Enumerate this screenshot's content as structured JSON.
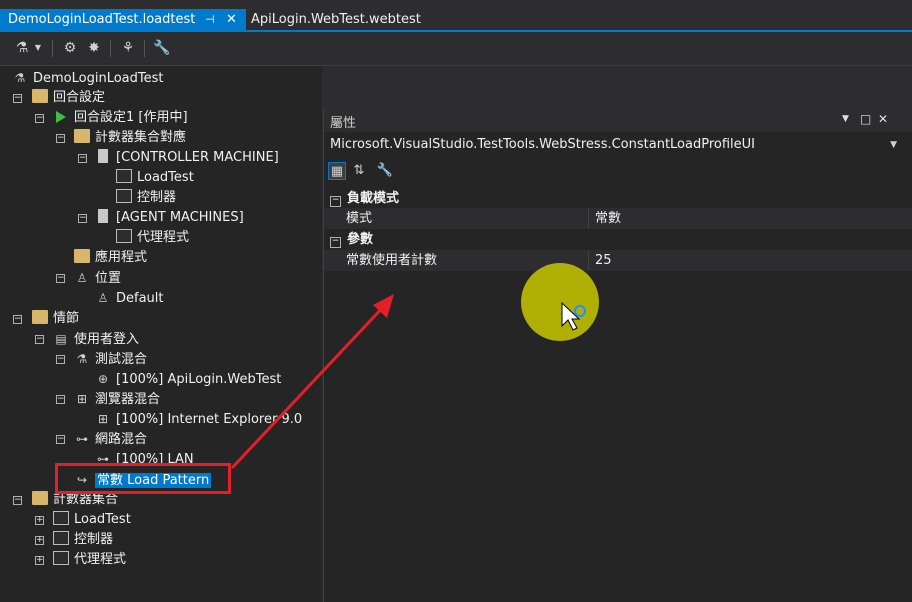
{
  "tabs": [
    {
      "label": "DemoLoginLoadTest.loadtest",
      "pin": "⊣",
      "close": "✕"
    },
    {
      "label": "ApiLogin.WebTest.webtest"
    }
  ],
  "tree": {
    "nodes": [
      {
        "label": "DemoLoginLoadTest"
      },
      {
        "label": "回合設定"
      },
      {
        "label": "回合設定1 [作用中]"
      },
      {
        "label": "計數器集合對應"
      },
      {
        "label": "[CONTROLLER MACHINE]"
      },
      {
        "label": "LoadTest"
      },
      {
        "label": "控制器"
      },
      {
        "label": "[AGENT MACHINES]"
      },
      {
        "label": "代理程式"
      },
      {
        "label": "應用程式"
      },
      {
        "label": "位置"
      },
      {
        "label": "Default"
      },
      {
        "label": "情節"
      },
      {
        "label": "使用者登入"
      },
      {
        "label": "測試混合"
      },
      {
        "label": "[100%] ApiLogin.WebTest"
      },
      {
        "label": "瀏覽器混合"
      },
      {
        "label": "[100%] Internet Explorer 9.0"
      },
      {
        "label": "網路混合"
      },
      {
        "label": "[100%] LAN"
      },
      {
        "label": "常數 Load Pattern"
      },
      {
        "label": "計數器集合"
      },
      {
        "label": "LoadTest"
      },
      {
        "label": "控制器"
      },
      {
        "label": "代理程式"
      }
    ]
  },
  "properties": {
    "title": "屬性",
    "type_name": "Microsoft.VisualStudio.TestTools.WebStress.ConstantLoadProfileUI",
    "categories": [
      {
        "name": "負載模式",
        "rows": [
          {
            "key": "模式",
            "value": "常數"
          }
        ]
      },
      {
        "name": "參數",
        "rows": [
          {
            "key": "常數使用者計數",
            "value": "25"
          }
        ]
      }
    ]
  },
  "colors": {
    "accent": "#007acc",
    "annotation": "#e51f28",
    "cursor_highlight": "#c8c800"
  }
}
